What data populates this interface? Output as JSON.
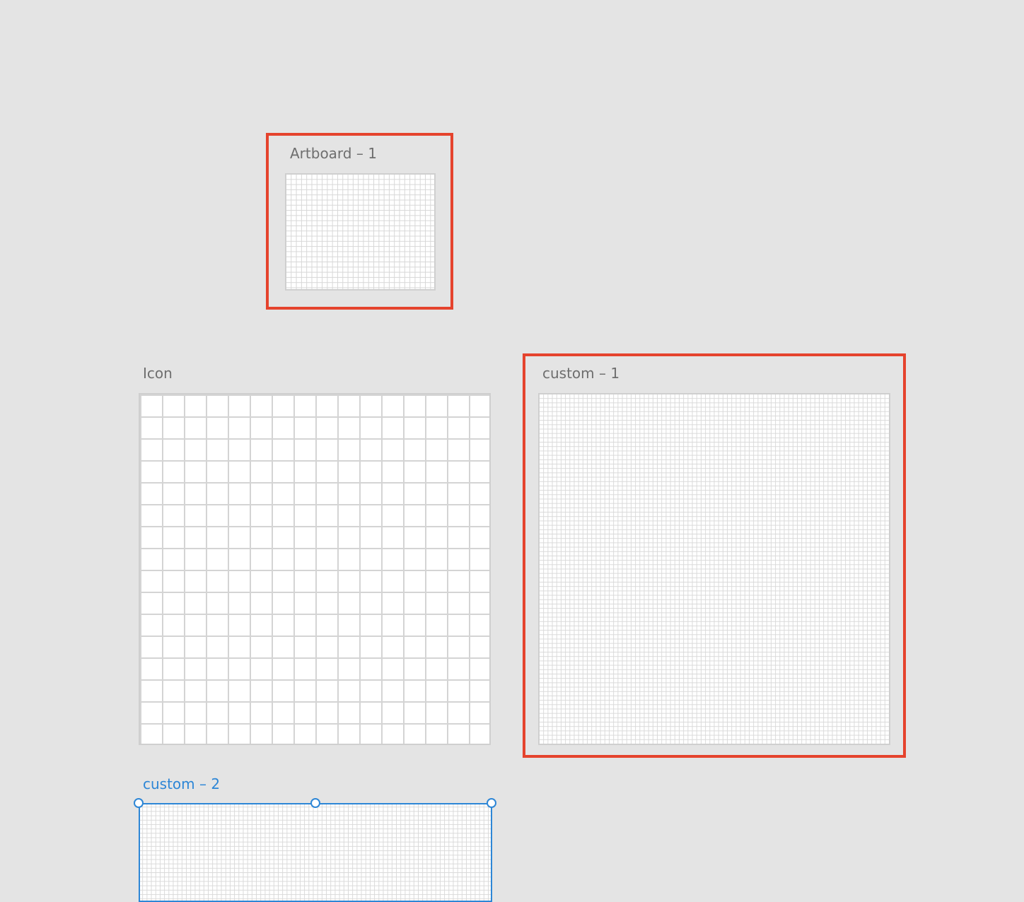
{
  "canvas": {
    "background_color": "#e4e4e4",
    "highlight_color": "#e5432d",
    "selection_color": "#2d86d6"
  },
  "artboards": [
    {
      "label": "Artboard – 1",
      "highlighted": true,
      "selected": false
    },
    {
      "label": "Icon",
      "highlighted": false,
      "selected": false
    },
    {
      "label": "custom – 1",
      "highlighted": true,
      "selected": false
    },
    {
      "label": "custom – 2",
      "highlighted": false,
      "selected": true
    }
  ]
}
